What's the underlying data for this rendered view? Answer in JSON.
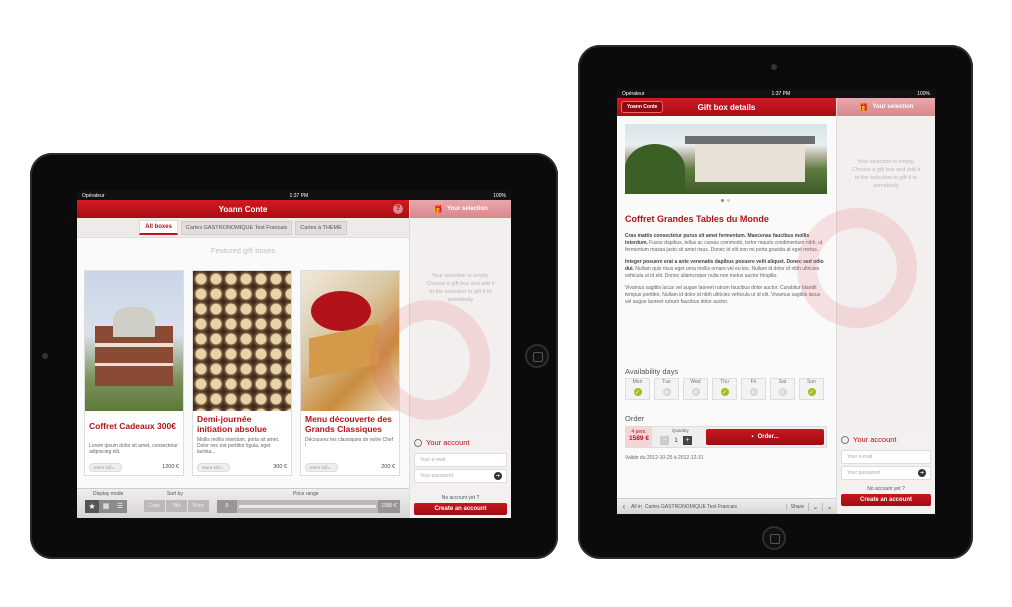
{
  "status": {
    "carrier": "Opérateur",
    "time": "1:37 PM",
    "battery": "100%"
  },
  "left": {
    "title": "Yoann Conte",
    "help_icon": "question-icon",
    "tabs": [
      "All boxes",
      "Cartes GASTRONOMIQUE Test Francais",
      "Cartes à THEME"
    ],
    "featured_label": "Featured gift boxes",
    "cards": [
      {
        "title": "Coffret Cadeaux 300€",
        "desc": "Lorem ipsum dolor sit amet, consectetur adipiscing elit.",
        "more": "More info...",
        "price": "1200 €"
      },
      {
        "title": "Demi-journée initiation absolue",
        "desc": "Mollis mollis interdum, porta sit amet. Dolor nec est porttitor ligula, eget lacinia...",
        "more": "More info...",
        "price": "300 €"
      },
      {
        "title": "Menu découverte des Grands Classiques",
        "desc": "Découvrez les classiques de notre Chef !",
        "more": "More info...",
        "price": "200 €"
      }
    ],
    "footer": {
      "display_mode": "Display mode",
      "sort_by": "Sort by",
      "sort_options": [
        "Date",
        "Title",
        "Price"
      ],
      "price_range": "Price range",
      "price_min": "0",
      "price_max": "1990 €"
    }
  },
  "sidebar": {
    "header": "Your selection",
    "empty_text": "Your selection is empty. Choose a gift box and add it to the selection to gift it to somebody",
    "account_title": "Your account",
    "email_placeholder": "Your e-mail",
    "password_placeholder": "Your password",
    "no_account": "No account yet ?",
    "create_account": "Create an account"
  },
  "right": {
    "back_label": "Yoann Conte",
    "title": "Gift box details",
    "product_title": "Coffret Grandes Tables du Monde",
    "para1_bold": "Cras mattis consectetur purus sit amet fermentum. Maecenas faucibus mollis interdum.",
    "para1": "Fusce dapibus, tellus ac cursus commodo, tortor mauris condimentum nibh, ut fermentum massa justo sit amet risus. Donec id elit non mi porta gravida at eget metus.",
    "para2_bold": "Integer posuere erat a ante venenatis dapibus posuere velit aliquet. Donec sed odio dui.",
    "para2": "Nullam quis risus eget urna mollis ornare vel eu leo. Nullam id dolor id nibh ultricies vehicula ut id elit. Donec ullamcorper nulla non metus auctor fringilla.",
    "para3": "Vivamus sagittis lacus vel augue laoreet rutrum faucibus dolor auctor. Curabitur blandit tempus porttitor. Nullam id dolor id nibh ultricies vehicula ut id elit. Vivamus sagittis lacus vel augue laoreet rutrum faucibus dolor auctor.",
    "availability_label": "Availability days",
    "days": [
      {
        "name": "Mon",
        "available": true
      },
      {
        "name": "Tue",
        "available": false
      },
      {
        "name": "Wed",
        "available": false
      },
      {
        "name": "Thu",
        "available": true
      },
      {
        "name": "Fri",
        "available": false
      },
      {
        "name": "Sat",
        "available": false
      },
      {
        "name": "Sun",
        "available": true
      }
    ],
    "order_label": "Order",
    "persons": "4 pers.",
    "price": "1589 €",
    "quantity_label": "Quantity",
    "quantity": "1",
    "order_button": "Order...",
    "validity": "Valide du 2012-10-25 à 2012-12-31",
    "bottom_nav": {
      "all_in": "All in",
      "category": "Cartes GASTRONOMIQUE  Test Francais",
      "share": "Share"
    }
  },
  "colors": {
    "brand_red": "#c3131b",
    "available_green": "#9cc11c"
  }
}
